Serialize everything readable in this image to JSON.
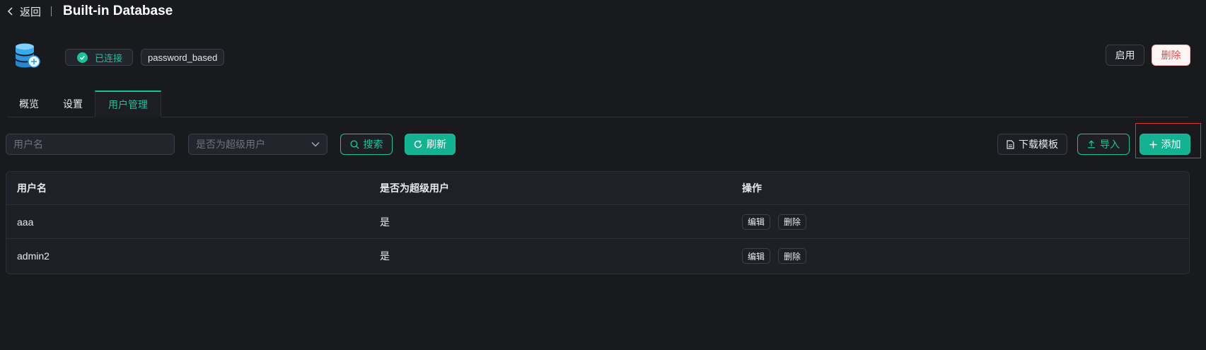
{
  "header": {
    "back_label": "返回",
    "title": "Built-in Database"
  },
  "db_info": {
    "status": "已连接",
    "auth_type": "password_based"
  },
  "actions": {
    "enable": "启用",
    "delete": "删除"
  },
  "tabs": [
    {
      "label": "概览"
    },
    {
      "label": "设置"
    },
    {
      "label": "用户管理"
    }
  ],
  "active_tab": "用户管理",
  "filters": {
    "username_placeholder": "用户名",
    "superuser_placeholder": "是否为超级用户",
    "search_label": "搜索",
    "refresh_label": "刷新"
  },
  "tools": {
    "download_template": "下载模板",
    "import": "导入",
    "add": "添加"
  },
  "table": {
    "columns": [
      "用户名",
      "是否为超级用户",
      "操作"
    ],
    "rows": [
      {
        "username": "aaa",
        "is_superuser": "是",
        "edit": "编辑",
        "delete": "删除"
      },
      {
        "username": "admin2",
        "is_superuser": "是",
        "edit": "编辑",
        "delete": "删除"
      }
    ]
  },
  "colors": {
    "accent": "#19c39a",
    "background": "#191a1e",
    "danger": "#e04c4c",
    "highlight": "#e03131"
  }
}
